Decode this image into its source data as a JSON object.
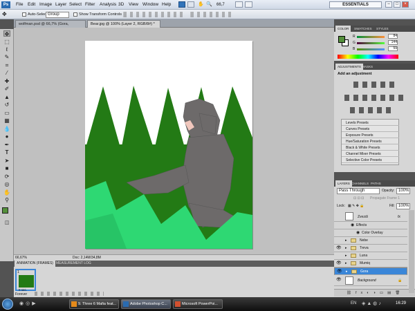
{
  "app": {
    "logo": "Ps",
    "menus": [
      "File",
      "Edit",
      "Image",
      "Layer",
      "Select",
      "Filter",
      "Analysis",
      "3D",
      "View",
      "Window",
      "Help"
    ],
    "zoom_display": "66,7",
    "workspace": "ESSENTIALS"
  },
  "options": {
    "auto_select_label": "Auto-Select:",
    "auto_select_value": "Group",
    "transform_label": "Show Transform Controls"
  },
  "tabs": [
    {
      "label": "wolfman.psd @ 66,7% (Gora, RGB/8) *",
      "active": false
    },
    {
      "label": "Bear.jpg @ 100% (Layer 2, RGB/8#) *",
      "active": true
    }
  ],
  "status": {
    "zoom": "66,67%",
    "doc": "Doc: 2,14M/34,8M"
  },
  "animation": {
    "tabs": [
      "ANIMATION (FRAMES)",
      "MEASUREMENT LOG"
    ],
    "frame_time": "0 sec.",
    "frame_number": "1",
    "loop": "Forever"
  },
  "color_panel": {
    "tabs": [
      "COLOR",
      "SWATCHES",
      "STYLES"
    ],
    "r": "84",
    "g": "144",
    "b": "59",
    "fg_color": "#54903b",
    "bg_color": "#ffffff"
  },
  "adjustments": {
    "tabs": [
      "ADJUSTMENTS",
      "MASKS"
    ],
    "heading": "Add an adjustment",
    "presets": [
      "Levels Presets",
      "Curves Presets",
      "Exposure Presets",
      "Hue/Saturation Presets",
      "Black & White Presets",
      "Channel Mixer Presets",
      "Selective Color Presets"
    ]
  },
  "layers_panel": {
    "tabs": [
      "LAYERS",
      "CHANNELS",
      "PATHS"
    ],
    "blend_mode": "Pass Through",
    "opacity_label": "Opacity:",
    "opacity": "100%",
    "lock_label": "Lock:",
    "fill_label": "Fill:",
    "fill": "100%",
    "propagate": "Propagate Frame 1",
    "layers": [
      {
        "name": "Zvezdi",
        "type": "layer",
        "visible": false,
        "fx": "fx"
      },
      {
        "name": "Effects",
        "type": "effects",
        "visible": false
      },
      {
        "name": "Color Overlay",
        "type": "effect",
        "visible": false
      },
      {
        "name": "Nebe",
        "type": "group",
        "visible": false
      },
      {
        "name": "Treva",
        "type": "group",
        "visible": true
      },
      {
        "name": "Luna",
        "type": "group",
        "visible": false
      },
      {
        "name": "Mumiq",
        "type": "group",
        "visible": true
      },
      {
        "name": "Gora",
        "type": "group",
        "visible": true,
        "selected": true
      },
      {
        "name": "Background",
        "type": "background",
        "visible": true
      }
    ]
  },
  "canvas": {
    "sky_color": "#ffffff",
    "tree_color": "#237a15",
    "grass_color": "#2ed873",
    "bear_color": "#6d6a6a"
  },
  "taskbar": {
    "tasks": [
      "9. Three 6 Mafia feat...",
      "Adobe Photoshop C...",
      "Microsoft PowerPoi..."
    ],
    "lang": "EN",
    "time": "16:29"
  }
}
